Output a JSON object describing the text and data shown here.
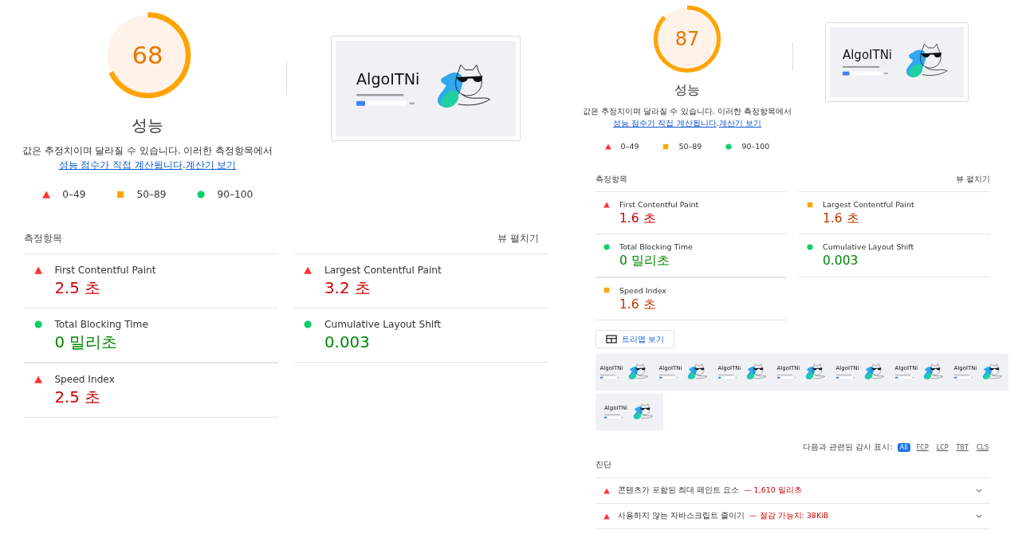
{
  "reports": [
    {
      "score": "68",
      "level": 0.68,
      "title": "성능",
      "note": "값은 추정치이며 달라질 수 있습니다. 이러한 측정항목에서",
      "note_link": "성능 점수가 직접 계산됩니다",
      "note_sep": ".",
      "calc_link": "계산기 보기",
      "legend": [
        {
          "kind": "fail",
          "label": "0–49"
        },
        {
          "kind": "average",
          "label": "50–89"
        },
        {
          "kind": "pass",
          "label": "90–100"
        }
      ],
      "preview": {
        "title": "AlgoITNi"
      },
      "metrics_heading": "측정항목",
      "expand_label": "뷰 펼치기",
      "metrics": [
        {
          "kind": "fail",
          "name": "First Contentful Paint",
          "value": "2.5 초"
        },
        {
          "kind": "fail",
          "name": "Largest Contentful Paint",
          "value": "3.2 초"
        },
        {
          "kind": "pass",
          "name": "Total Blocking Time",
          "value": "0 밀리초"
        },
        {
          "kind": "pass",
          "name": "Cumulative Layout Shift",
          "value": "0.003"
        },
        {
          "kind": "fail",
          "name": "Speed Index",
          "value": "2.5 초"
        }
      ]
    },
    {
      "score": "87",
      "level": 0.87,
      "title": "성능",
      "note": "값은 추정치이며 달라질 수 있습니다. 이러한 측정항목에서",
      "note_link": "성능 점수가 직접 계산됩니다",
      "note_sep": ".",
      "calc_link": "계산기 보기",
      "legend": [
        {
          "kind": "fail",
          "label": "0–49"
        },
        {
          "kind": "average",
          "label": "50–89"
        },
        {
          "kind": "pass",
          "label": "90–100"
        }
      ],
      "preview": {
        "title": "AlgoITNi"
      },
      "metrics_heading": "측정항목",
      "expand_label": "뷰 펼치기",
      "metrics": [
        {
          "kind": "fail",
          "name": "First Contentful Paint",
          "value": "1.6 초"
        },
        {
          "kind": "average",
          "name": "Largest Contentful Paint",
          "value": "1.6 초"
        },
        {
          "kind": "pass",
          "name": "Total Blocking Time",
          "value": "0 밀리초"
        },
        {
          "kind": "pass",
          "name": "Cumulative Layout Shift",
          "value": "0.003"
        },
        {
          "kind": "average",
          "name": "Speed Index",
          "value": "1.6 초"
        }
      ],
      "treemap_button": "트리맵 보기",
      "filmstrip": [
        {
          "title": "AlgoITNi"
        },
        {
          "title": "AlgoITNi"
        },
        {
          "title": "AlgoITNi"
        },
        {
          "title": "AlgoITNi"
        },
        {
          "title": "AlgoITNi"
        },
        {
          "title": "AlgoITNi"
        },
        {
          "title": "AlgoITNi"
        },
        {
          "title": "AlgoITNi"
        }
      ],
      "filter_label": "다음과 관련된 감사 표시:",
      "filters": [
        {
          "label": "All",
          "selected": true
        },
        {
          "label": "FCP",
          "selected": false
        },
        {
          "label": "LCP",
          "selected": false
        },
        {
          "label": "TBT",
          "selected": false
        },
        {
          "label": "CLS",
          "selected": false
        }
      ],
      "diagnostics_heading": "진단",
      "diagnostics": [
        {
          "kind": "fail",
          "title": "콘텐츠가 포함된 최대 페인트 요소",
          "detail": "— 1,610 밀리초"
        },
        {
          "kind": "fail",
          "title": "사용하지 않는 자바스크립트 줄이기",
          "detail": "— 절감 가능치: 38KiB"
        }
      ]
    }
  ]
}
